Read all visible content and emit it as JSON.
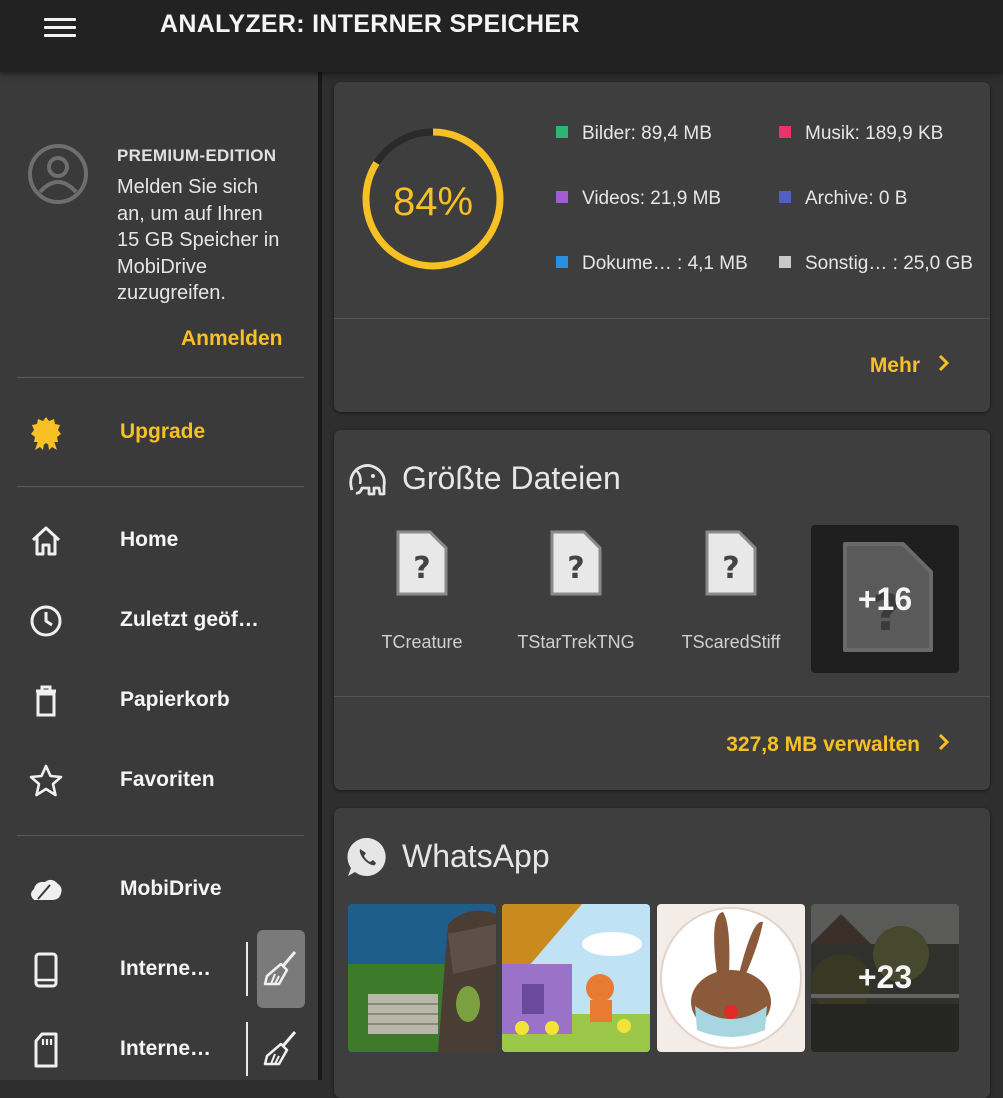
{
  "header": {
    "title": "ANALYZER: INTERNER SPEICHER",
    "menu_icon": "hamburger-menu-icon"
  },
  "sidebar": {
    "premium_title": "PREMIUM-EDITION",
    "premium_text": "Melden Sie sich an, um auf Ihren 15 GB Speicher in MobiDrive zuzugreifen.",
    "signin_label": "Anmelden",
    "upgrade_label": "Upgrade",
    "items": [
      {
        "label": "Home",
        "icon": "home-icon"
      },
      {
        "label": "Zuletzt geöf…",
        "icon": "clock-icon"
      },
      {
        "label": "Papierkorb",
        "icon": "trash-icon"
      },
      {
        "label": "Favoriten",
        "icon": "star-icon"
      }
    ],
    "mobidrive_label": "MobiDrive",
    "storage": [
      {
        "label": "Interne…",
        "icon": "phone-icon",
        "clean_icon": "broom-icon"
      },
      {
        "label": "Interne…",
        "icon": "sd-card-icon",
        "clean_icon": "broom-icon"
      }
    ]
  },
  "analyzer": {
    "percent": "84%",
    "used_fraction": 0.84,
    "legend": [
      {
        "label": "Bilder: 89,4 MB",
        "color": "#2bb673"
      },
      {
        "label": "Musik: 189,9 KB",
        "color": "#e8336b"
      },
      {
        "label": "Videos: 21,9 MB",
        "color": "#a25bd0"
      },
      {
        "label": "Archive: 0 B",
        "color": "#4f5fc4"
      },
      {
        "label": "Dokume…  : 4,1 MB",
        "color": "#2b8fe0"
      },
      {
        "label": "Sonstig…  : 25,0 GB",
        "color": "#c8c8c8"
      }
    ],
    "more_label": "Mehr",
    "ring_color": "#f7c024"
  },
  "largest_files": {
    "title": "Größte Dateien",
    "icon": "elephant-icon",
    "files": [
      {
        "name": "TCreature"
      },
      {
        "name": "TStarTrekTNG"
      },
      {
        "name": "TScaredStiff"
      }
    ],
    "more_count": "+16",
    "manage_label": "327,8 MB verwalten"
  },
  "whatsapp": {
    "title": "WhatsApp",
    "icon": "whatsapp-icon",
    "more_count": "+23"
  },
  "colors": {
    "accent": "#f7c024",
    "background": "#2e2e2e",
    "card": "#3e3e3e",
    "sidebar": "#3a3a3a"
  }
}
